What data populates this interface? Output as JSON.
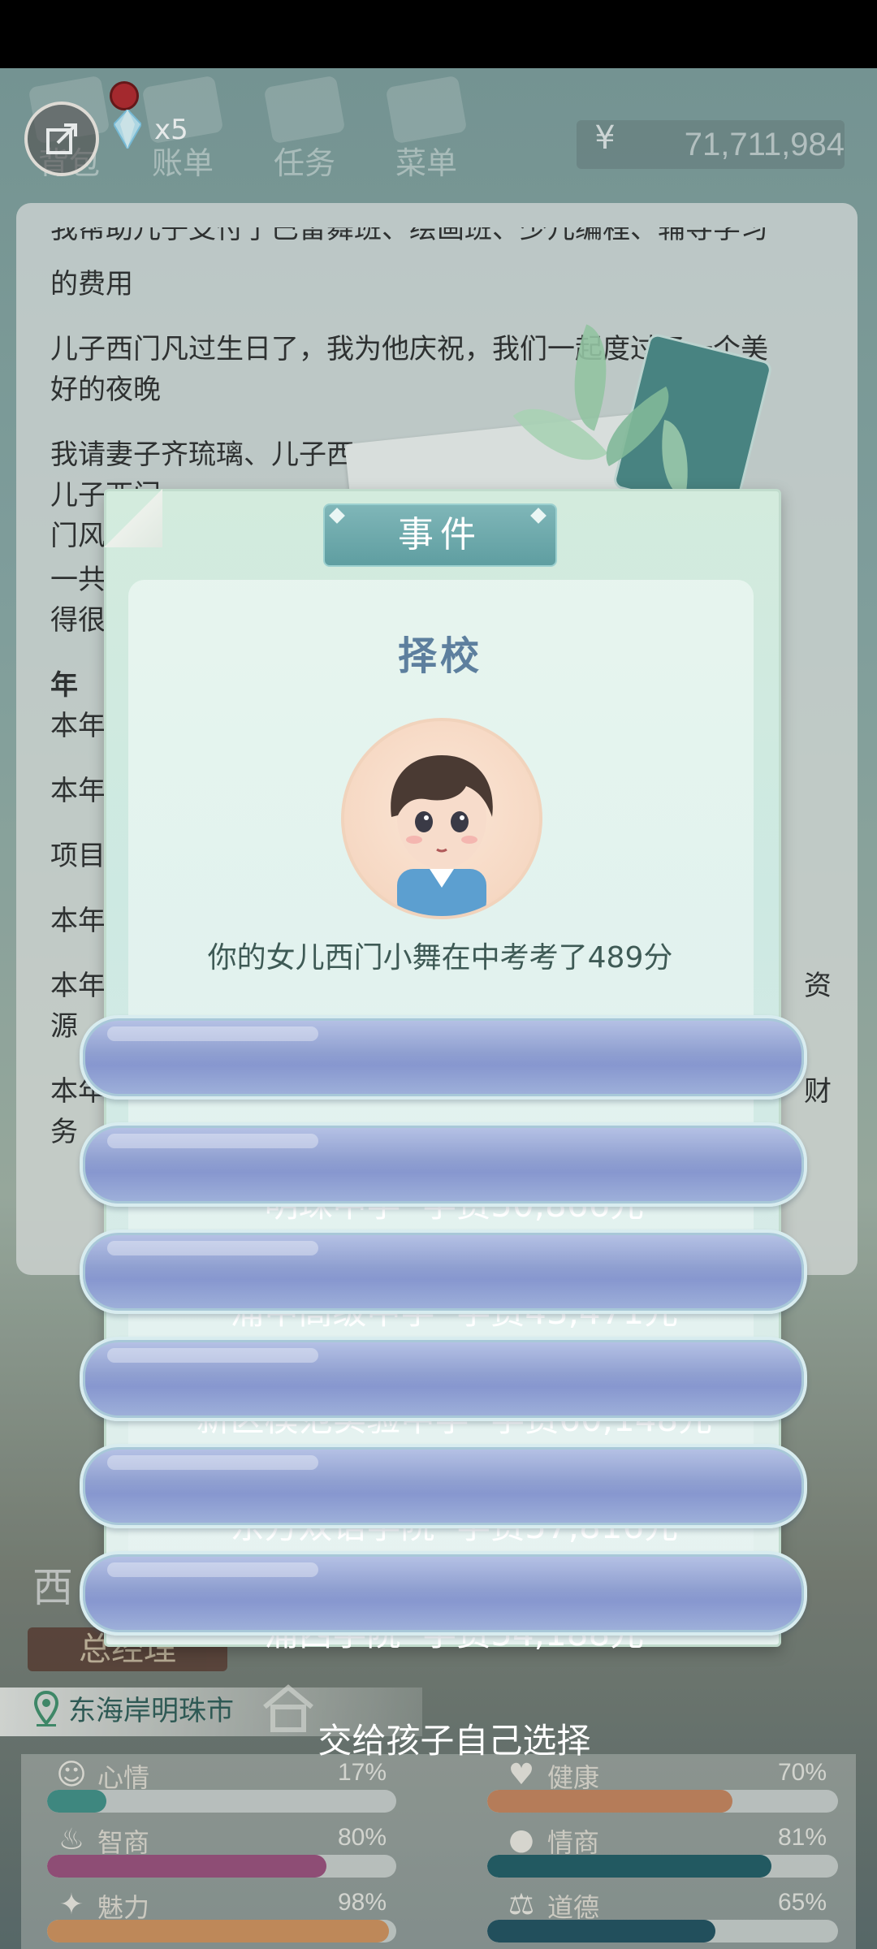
{
  "topbar": {
    "tabs": [
      "背包",
      "账单",
      "任务",
      "菜单"
    ],
    "gem_count": "x5",
    "currency_symbol": "¥",
    "money": "71,711,984"
  },
  "log": {
    "lines": [
      "我帮助儿子支付了巴雷舞班、绘画班、少儿编程、辅导学习",
      "的费用",
      "儿子西门凡过生日了，我为他庆祝，我们一起度过了一个美",
      "好的夜晚",
      "我请妻子齐琉璃、儿子西",
      "儿子西门",
      "门风",
      "一共",
      "得很",
      "年",
      "本年",
      "本年",
      "项目",
      "本年",
      "本年",
      "源",
      "本年",
      "务",
      "资",
      "财"
    ]
  },
  "modal": {
    "header": "事件",
    "title": "择校",
    "message": "你的女儿西门小舞在中考考了489分",
    "options": [
      "明珠中学  学费50,866元",
      "浦中高级中学  学费43,471元",
      "新区模范实验中学  学费60,148元",
      "东方双语学院  学费57,816元",
      "浦西学院  学费54,188元",
      "交给孩子自己选择"
    ]
  },
  "profile": {
    "name_partial": "西",
    "title": "总经理",
    "location": "东海岸明珠市"
  },
  "stats": [
    {
      "label": "心情",
      "pct": "17%",
      "value": 0.17,
      "color": "#3f8f86",
      "icon": "smile-icon"
    },
    {
      "label": "健康",
      "pct": "70%",
      "value": 0.7,
      "color": "#c7825b",
      "icon": "heart-icon"
    },
    {
      "label": "智商",
      "pct": "80%",
      "value": 0.8,
      "color": "#9a4d7a",
      "icon": "bulb-icon"
    },
    {
      "label": "情商",
      "pct": "81%",
      "value": 0.81,
      "color": "#1f5a63",
      "icon": "apple-icon"
    },
    {
      "label": "魅力",
      "pct": "98%",
      "value": 0.98,
      "color": "#d1905a",
      "icon": "sparkle-icon"
    },
    {
      "label": "道德",
      "pct": "65%",
      "value": 0.65,
      "color": "#1f4f5e",
      "icon": "scales-icon"
    }
  ]
}
